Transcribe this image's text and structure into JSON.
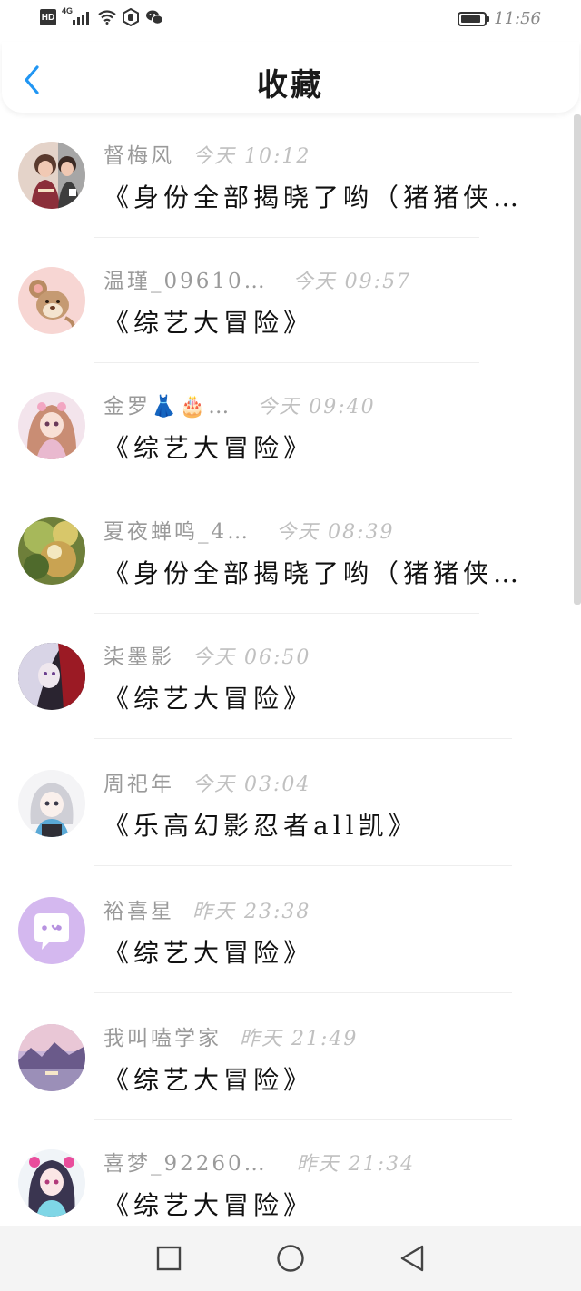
{
  "status_bar": {
    "network_badge": "HD",
    "signal_label": "4G",
    "signal_level": 4,
    "battery_fraction": 0.85,
    "time": "11:56",
    "icons": [
      "hd-icon",
      "signal-icon",
      "wifi-icon",
      "notification-icon",
      "wechat-icon",
      "battery-icon"
    ]
  },
  "header": {
    "back_icon": "chevron-left-icon",
    "title": "收藏",
    "accent_color": "#2196F3"
  },
  "favorites": [
    {
      "user": "督梅风",
      "time": "今天 10:12",
      "title": "《身份全部揭晓了哟（猪猪侠…"
    },
    {
      "user": "温瑾_09610…",
      "time": "今天 09:57",
      "title": "《综艺大冒险》"
    },
    {
      "user": "金罗👗🎂…",
      "time": "今天 09:40",
      "title": "《综艺大冒险》"
    },
    {
      "user": "夏夜蝉鸣_4…",
      "time": "今天 08:39",
      "title": "《身份全部揭晓了哟（猪猪侠…"
    },
    {
      "user": "柒墨影",
      "time": "今天 06:50",
      "title": "《综艺大冒险》"
    },
    {
      "user": "周祀年",
      "time": "今天 03:04",
      "title": "《乐高幻影忍者all凯》"
    },
    {
      "user": "裕喜星",
      "time": "昨天 23:38",
      "title": "《综艺大冒险》"
    },
    {
      "user": "我叫嗑学家",
      "time": "昨天 21:49",
      "title": "《综艺大冒险》"
    },
    {
      "user": "喜梦_92260…",
      "time": "昨天 21:34",
      "title": "《综艺大冒险》"
    }
  ],
  "nav": {
    "buttons": [
      "recent-apps-icon",
      "home-icon",
      "back-icon"
    ]
  }
}
